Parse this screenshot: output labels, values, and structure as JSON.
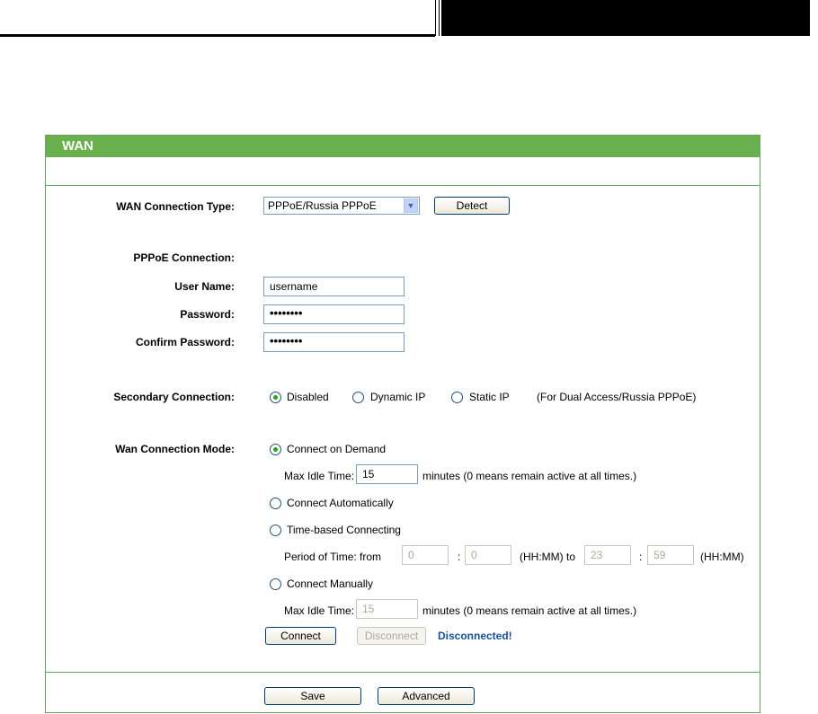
{
  "panel": {
    "title": "WAN"
  },
  "wan_type": {
    "label": "WAN Connection Type:",
    "selected": "PPPoE/Russia PPPoE",
    "detect_label": "Detect"
  },
  "pppoe": {
    "heading": "PPPoE Connection:",
    "username_label": "User Name:",
    "username_value": "username",
    "password_label": "Password:",
    "password_value": "••••••••",
    "confirm_label": "Confirm Password:",
    "confirm_value": "••••••••"
  },
  "secondary": {
    "label": "Secondary Connection:",
    "options": [
      "Disabled",
      "Dynamic IP",
      "Static IP"
    ],
    "selected": "Disabled",
    "note": "(For Dual Access/Russia PPPoE)"
  },
  "mode": {
    "label": "Wan Connection Mode:",
    "on_demand": "Connect on Demand",
    "max_idle_label": "Max Idle Time:",
    "max_idle_value": "15",
    "max_idle_note": "minutes (0 means remain active at all times.)",
    "auto": "Connect Automatically",
    "time_based": "Time-based Connecting",
    "period_label": "Period of Time: from",
    "from_hh": "0",
    "colon": ":",
    "from_mm": "0",
    "to_label": "(HH:MM) to",
    "to_hh": "23",
    "to_mm": "59",
    "hhmm": "(HH:MM)",
    "manual": "Connect Manually",
    "manual_idle_label": "Max Idle Time:",
    "manual_idle_value": "15",
    "manual_idle_note": "minutes (0 means remain active at all times.)",
    "selected": "Connect on Demand"
  },
  "actions": {
    "connect": "Connect",
    "disconnect": "Disconnect",
    "status": "Disconnected!",
    "save": "Save",
    "advanced": "Advanced"
  },
  "colors": {
    "header_green": "#6ab04c",
    "status_blue": "#1a4ea0"
  }
}
